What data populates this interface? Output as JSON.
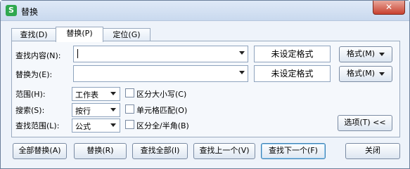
{
  "window": {
    "title": "替换",
    "app_icon": "S"
  },
  "tabs": [
    {
      "label": "查找(D)"
    },
    {
      "label": "替换(P)"
    },
    {
      "label": "定位(G)"
    }
  ],
  "find": {
    "label": "查找内容(N):",
    "value": "",
    "format_status": "未设定格式",
    "format_button": "格式(M)"
  },
  "replace": {
    "label": "替换为(E):",
    "value": "",
    "format_status": "未设定格式",
    "format_button": "格式(M)"
  },
  "options": {
    "scope_label": "范围(H):",
    "scope_value": "工作表",
    "search_label": "搜索(S):",
    "search_value": "按行",
    "lookin_label": "查找范围(L):",
    "lookin_value": "公式",
    "match_case": "区分大小写(C)",
    "match_cell": "单元格匹配(O)",
    "match_width": "区分全/半角(B)",
    "options_button": "选项(T) <<"
  },
  "buttons": {
    "replace_all": "全部替换(A)",
    "replace": "替换(R)",
    "find_all": "查找全部(I)",
    "find_prev": "查找上一个(V)",
    "find_next": "查找下一个(F)",
    "close": "关闭"
  }
}
